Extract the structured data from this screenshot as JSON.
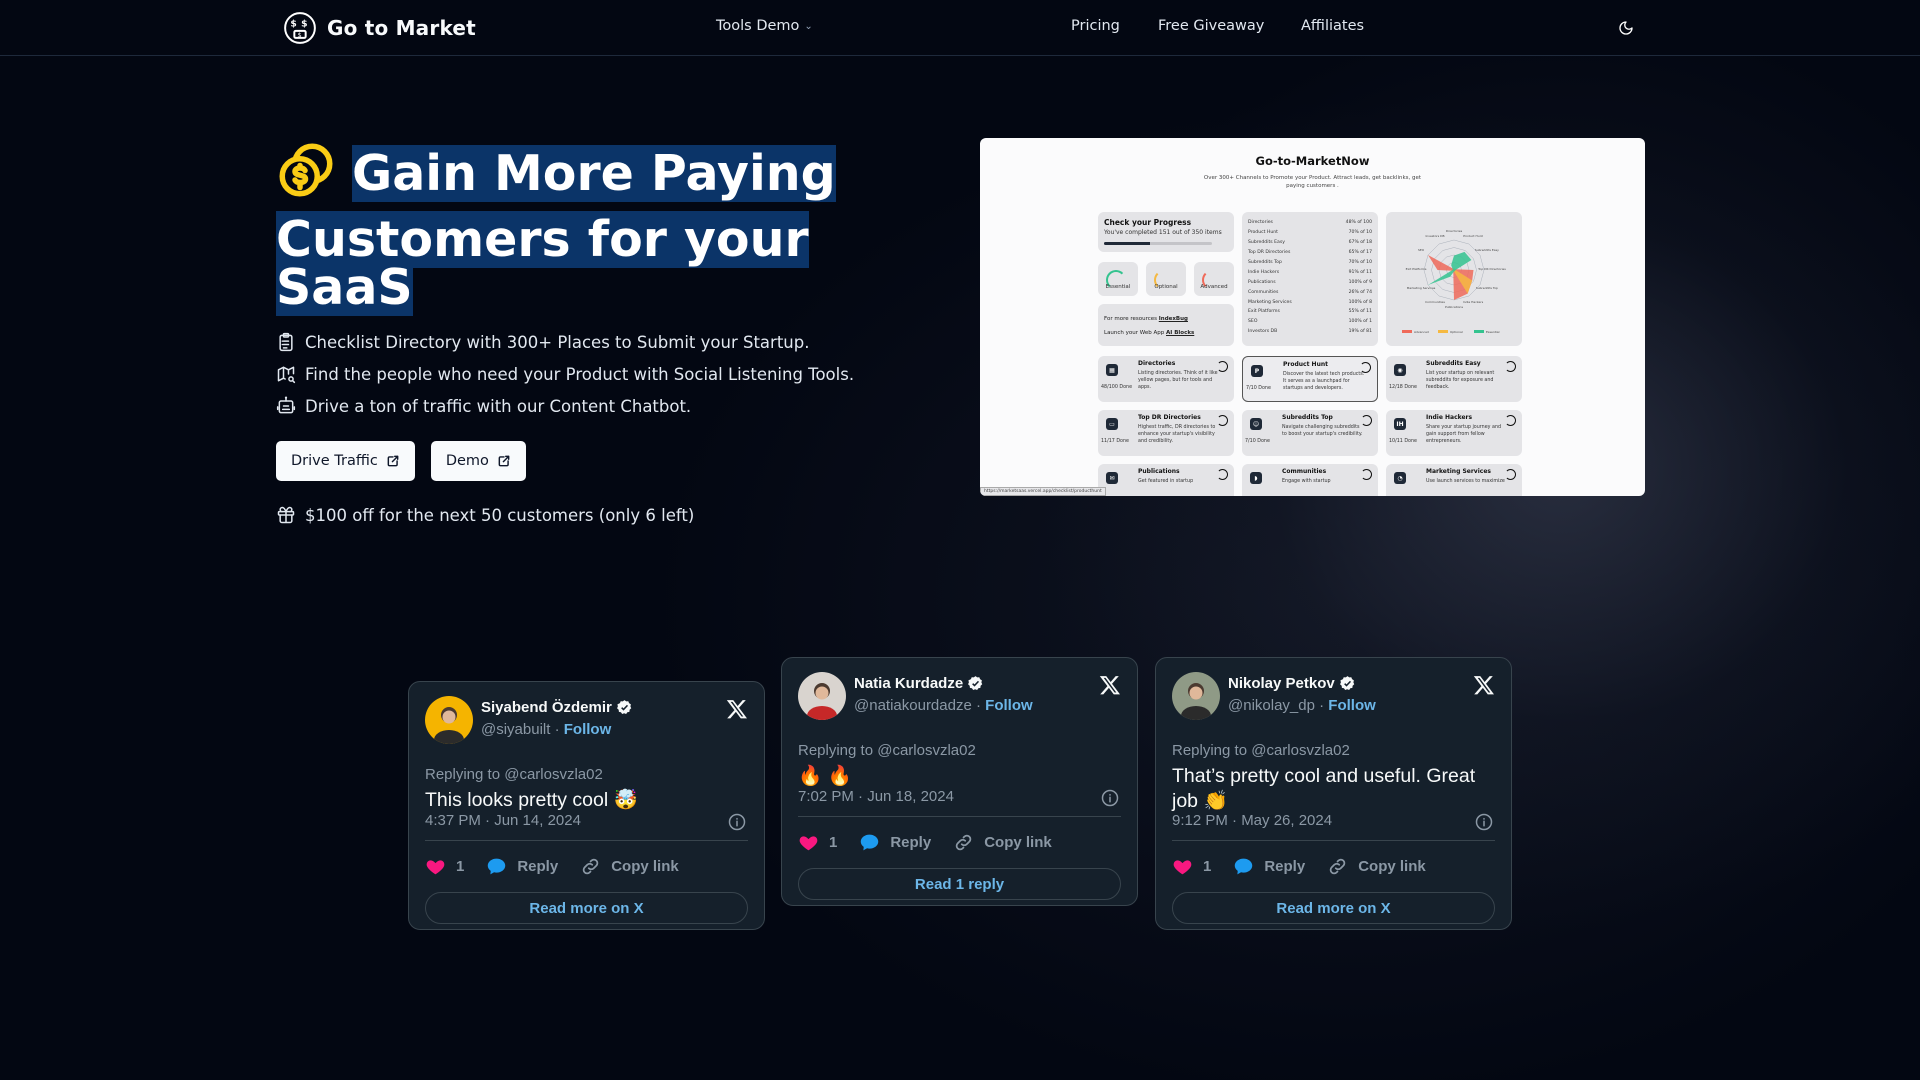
{
  "nav": {
    "brand": "Go to Market",
    "tools_menu": "Tools Demo",
    "links": [
      "Pricing",
      "Free Giveaway",
      "Affiliates"
    ],
    "theme_icon": "moon-icon"
  },
  "hero": {
    "title_line1": "Gain More Paying",
    "title_line2": "Customers for your",
    "title_line3": "SaaS",
    "bullets": [
      {
        "icon": "clipboard-list-icon",
        "text": "Checklist Directory with 300+ Places to Submit your Startup."
      },
      {
        "icon": "map-search-icon",
        "text": "Find the people who need your Product with Social Listening Tools."
      },
      {
        "icon": "robot-icon",
        "text": "Drive a ton of traffic with our Content Chatbot."
      }
    ],
    "buttons": [
      {
        "label": "Drive Traffic",
        "icon": "external-link-icon"
      },
      {
        "label": "Demo",
        "icon": "external-link-icon"
      }
    ],
    "offer": "$100 off for the next 50 customers (only 6 left)",
    "accent_color": "#facc15",
    "highlight_color": "#0b3468"
  },
  "preview": {
    "title": "Go-to-MarketNow",
    "subtitle": "Over 300+ Channels to Promote your Product. Attract leads, get backlinks, get paying customers .",
    "progress": {
      "title": "Check your Progress",
      "text": "You've completed 151 out of 350 items",
      "fraction": 0.43
    },
    "gauges": [
      {
        "label": "Essential",
        "color": "#34c38f"
      },
      {
        "label": "Optional",
        "color": "#f5b942"
      },
      {
        "label": "Advanced",
        "color": "#ef6a5a"
      }
    ],
    "resources": {
      "line1_prefix": "For more resources",
      "line1_link": "IndexBug",
      "line2_prefix": "Launch your Web App",
      "line2_link": "AI Blocks"
    },
    "categories": [
      {
        "name": "Directories",
        "value": "48% of 100"
      },
      {
        "name": "Product Hunt",
        "value": "70% of 10"
      },
      {
        "name": "Subreddits Easy",
        "value": "67% of 18"
      },
      {
        "name": "Top DR Directories",
        "value": "65% of 17"
      },
      {
        "name": "Subreddits Top",
        "value": "70% of 10"
      },
      {
        "name": "Indie Hackers",
        "value": "91% of 11"
      },
      {
        "name": "Publications",
        "value": "100% of 9"
      },
      {
        "name": "Communities",
        "value": "26% of 74"
      },
      {
        "name": "Marketing Services",
        "value": "100% of 8"
      },
      {
        "name": "Exit Platforms",
        "value": "55% of 11"
      },
      {
        "name": "SEO",
        "value": "100% of 1"
      },
      {
        "name": "Investors DB",
        "value": "19% of 81"
      }
    ],
    "legend": [
      "Advanced",
      "Optional",
      "Essential"
    ],
    "tasks": [
      {
        "title": "Directories",
        "done": "48/100 Done",
        "desc": "Listing directories. Think of it like yellow pages, but for tools and apps.",
        "icon": "grid-icon"
      },
      {
        "title": "Product Hunt",
        "done": "7/10 Done",
        "desc": "Discover the latest tech products. It serves as a launchpad for startups and developers.",
        "icon": "product-hunt-icon"
      },
      {
        "title": "Subreddits Easy",
        "done": "12/18 Done",
        "desc": "List your startup on relevant subreddits for exposure and feedback.",
        "icon": "reddit-icon"
      },
      {
        "title": "Top DR Directories",
        "done": "11/17 Done",
        "desc": "Highest traffic, DR directories to enhance your startup's visibility and credibility.",
        "icon": "monitor-icon"
      },
      {
        "title": "Subreddits Top",
        "done": "7/10 Done",
        "desc": "Navigate challenging subreddits to boost your startup's credibility.",
        "icon": "reddit-alien-icon"
      },
      {
        "title": "Indie Hackers",
        "done": "10/11 Done",
        "desc": "Share your startup journey and gain support from fellow entrepreneurs.",
        "icon": "indie-hackers-icon"
      },
      {
        "title": "Publications",
        "done": "",
        "desc": "Get featured in startup",
        "icon": "mail-icon"
      },
      {
        "title": "Communities",
        "done": "",
        "desc": "Engage with startup",
        "icon": "discord-icon"
      },
      {
        "title": "Marketing Services",
        "done": "",
        "desc": "Use launch services to maximize",
        "icon": "megaphone-icon"
      }
    ],
    "status_url": "https://marketsaas.vercel.app/checklist/producthunt"
  },
  "tweets": [
    {
      "name": "Siyabend Özdemir",
      "handle": "@siyabuilt",
      "follow": "Follow",
      "replying": "Replying to @carlosvzla02",
      "text": "This looks pretty cool 🤯",
      "time": "4:37 PM · Jun 14, 2024",
      "likes": "1",
      "reply": "Reply",
      "copy": "Copy link",
      "read": "Read more on X",
      "avatar_color": "#f5b400"
    },
    {
      "name": "Natia Kurdadze",
      "handle": "@natiakourdadze",
      "follow": "Follow",
      "replying": "Replying to @carlosvzla02",
      "text": "🔥 🔥",
      "time": "7:02 PM · Jun 18, 2024",
      "likes": "1",
      "reply": "Reply",
      "copy": "Copy link",
      "read": "Read 1 reply",
      "avatar_color": "#d9d4cf"
    },
    {
      "name": "Nikolay Petkov",
      "handle": "@nikolay_dp",
      "follow": "Follow",
      "replying": "Replying to @carlosvzla02",
      "text": "That’s pretty cool and useful. Great job 👏",
      "time": "9:12 PM · May 26, 2024",
      "likes": "1",
      "reply": "Reply",
      "copy": "Copy link",
      "read": "Read more on X",
      "avatar_color": "#8f9a86"
    }
  ]
}
